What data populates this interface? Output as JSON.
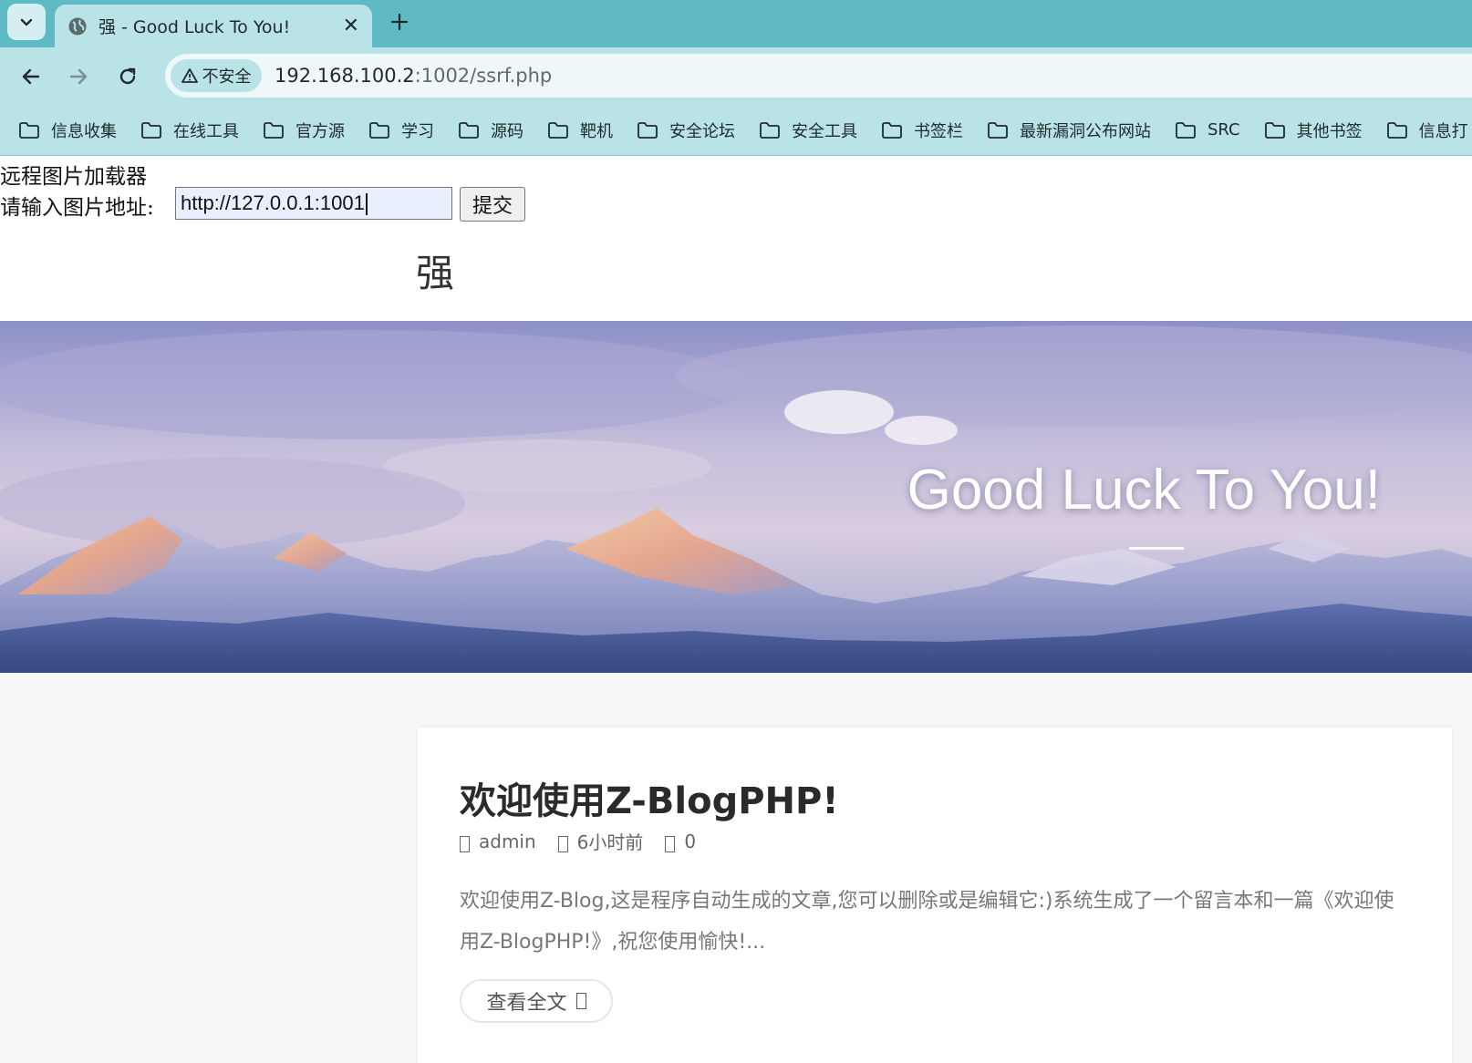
{
  "browser": {
    "tab": {
      "title": "强 - Good Luck To You!"
    },
    "address": {
      "security_label": "不安全",
      "host": "192.168.100.2",
      "path": ":1002/ssrf.php"
    },
    "bookmarks": [
      "信息收集",
      "在线工具",
      "官方源",
      "学习",
      "源码",
      "靶机",
      "安全论坛",
      "安全工具",
      "书签栏",
      "最新漏洞公布网站",
      "SRC",
      "其他书签",
      "信息打"
    ]
  },
  "loader": {
    "title": "远程图片加载器",
    "label": "请输入图片地址:",
    "input_value": "http://127.0.0.1:1001",
    "submit_label": "提交"
  },
  "site": {
    "logo": "强",
    "banner_title": "Good Luck To You!"
  },
  "post": {
    "title": "欢迎使用Z-BlogPHP!",
    "meta": {
      "author": "admin",
      "time": "6小时前",
      "comments": "0"
    },
    "excerpt": "欢迎使用Z-Blog,这是程序自动生成的文章,您可以删除或是编辑它:)系统生成了一个留言本和一篇《欢迎使用Z-BlogPHP!》,祝您使用愉快!...",
    "read_more": "查看全文"
  },
  "colors": {
    "tab_strip": "#5fbac4",
    "toolbar": "#b9e3e7",
    "omnibox": "#eef8f9",
    "content_bg": "#f5f7f9"
  }
}
